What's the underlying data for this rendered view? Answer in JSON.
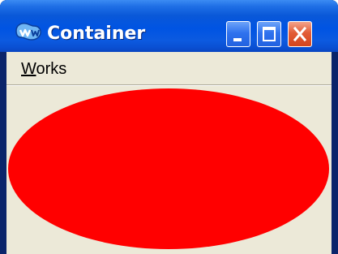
{
  "window": {
    "title": "Container",
    "icon": "app-icon",
    "controls": {
      "minimize": "minimize-icon",
      "maximize": "maximize-icon",
      "close": "close-icon"
    }
  },
  "menubar": {
    "items": [
      {
        "label": "Works",
        "mnemonic": "W",
        "rest": "orks"
      }
    ]
  },
  "canvas": {
    "shape": "ellipse",
    "fill_color": "#ff0000",
    "background_color": "#ece9d8"
  },
  "colors": {
    "titlebar_blue": "#0054e3",
    "close_red": "#d6451c",
    "client_face": "#ece9d8"
  }
}
